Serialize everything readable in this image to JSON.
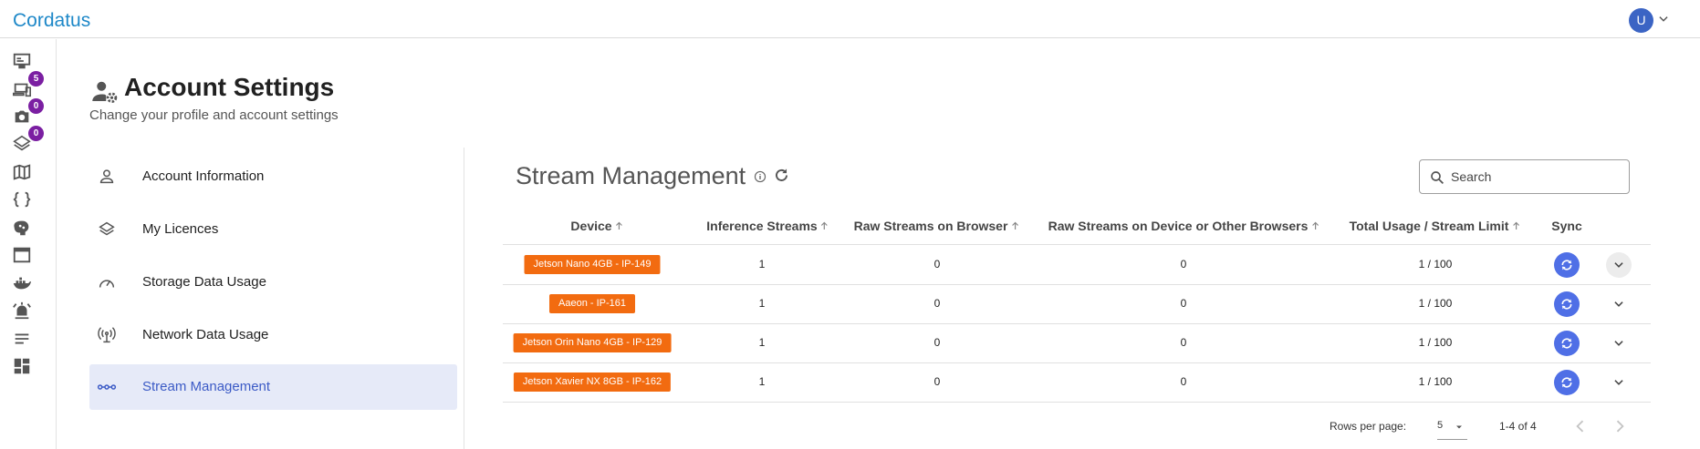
{
  "app": {
    "brand": "Cordatus",
    "user_initial": "U"
  },
  "rail": {
    "items": [
      {
        "icon": "monitor-icon",
        "badge": ""
      },
      {
        "icon": "devices-icon",
        "badge": "5"
      },
      {
        "icon": "camera-icon",
        "badge": "0"
      },
      {
        "icon": "layers-icon",
        "badge": "0"
      },
      {
        "icon": "map-icon",
        "badge": ""
      },
      {
        "icon": "code-braces-icon",
        "badge": ""
      },
      {
        "icon": "brain-icon",
        "badge": ""
      },
      {
        "icon": "window-icon",
        "badge": ""
      },
      {
        "icon": "docker-icon",
        "badge": ""
      },
      {
        "icon": "alarm-icon",
        "badge": ""
      },
      {
        "icon": "list-icon",
        "badge": ""
      },
      {
        "icon": "dashboard-icon",
        "badge": ""
      }
    ]
  },
  "header": {
    "title": "Account Settings",
    "subtitle": "Change your profile and account settings"
  },
  "menu": {
    "items": [
      {
        "label": "Account Information",
        "icon": "person-icon",
        "active": false
      },
      {
        "label": "My Licences",
        "icon": "layers-icon",
        "active": false
      },
      {
        "label": "Storage Data Usage",
        "icon": "speedometer-icon",
        "active": false
      },
      {
        "label": "Network Data Usage",
        "icon": "antenna-icon",
        "active": false
      },
      {
        "label": "Stream Management",
        "icon": "stream-icon",
        "active": true
      }
    ]
  },
  "panel": {
    "title": "Stream Management",
    "search_placeholder": "Search"
  },
  "table": {
    "columns": [
      "Device",
      "Inference Streams",
      "Raw Streams on Browser",
      "Raw Streams on Device or Other Browsers",
      "Total Usage / Stream Limit",
      "Sync"
    ],
    "rows": [
      {
        "device": "Jetson Nano 4GB - IP-149",
        "inference": "1",
        "raw_browser": "0",
        "raw_device": "0",
        "usage": "1 / 100"
      },
      {
        "device": "Aaeon - IP-161",
        "inference": "1",
        "raw_browser": "0",
        "raw_device": "0",
        "usage": "1 / 100"
      },
      {
        "device": "Jetson Orin Nano 4GB - IP-129",
        "inference": "1",
        "raw_browser": "0",
        "raw_device": "0",
        "usage": "1 / 100"
      },
      {
        "device": "Jetson Xavier NX 8GB - IP-162",
        "inference": "1",
        "raw_browser": "0",
        "raw_device": "0",
        "usage": "1 / 100"
      }
    ]
  },
  "pagination": {
    "rows_per_page_label": "Rows per page:",
    "rows_per_page_value": "5",
    "range": "1-4 of 4"
  },
  "colors": {
    "brand": "#1e88c8",
    "chip": "#f26b10",
    "accent": "#3c5bc6",
    "badge": "#7b1fa2"
  }
}
